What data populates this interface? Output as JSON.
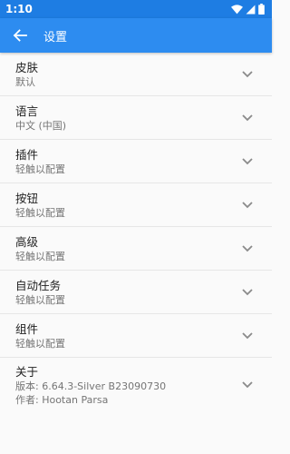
{
  "status": {
    "time": "1:10"
  },
  "appbar": {
    "title": "设置"
  },
  "items": [
    {
      "title": "皮肤",
      "subtitle": "默认"
    },
    {
      "title": "语言",
      "subtitle": "中文 (中国)"
    },
    {
      "title": "插件",
      "subtitle": "轻触以配置"
    },
    {
      "title": "按钮",
      "subtitle": "轻触以配置"
    },
    {
      "title": "高级",
      "subtitle": "轻触以配置"
    },
    {
      "title": "自动任务",
      "subtitle": "轻触以配置"
    },
    {
      "title": "组件",
      "subtitle": "轻触以配置"
    },
    {
      "title": "关于",
      "subtitle": "版本: 6.64.3-Silver  B23090730",
      "subtitle2": "作者: Hootan Parsa"
    }
  ],
  "colors": {
    "status_bar": "#1e7de3",
    "app_bar": "#2d8cf0",
    "background": "#fafafa"
  },
  "icons": {
    "back": "arrow-back-icon",
    "expand": "chevron-down-icon",
    "wifi": "wifi-icon",
    "signal": "signal-icon",
    "battery": "battery-icon"
  }
}
